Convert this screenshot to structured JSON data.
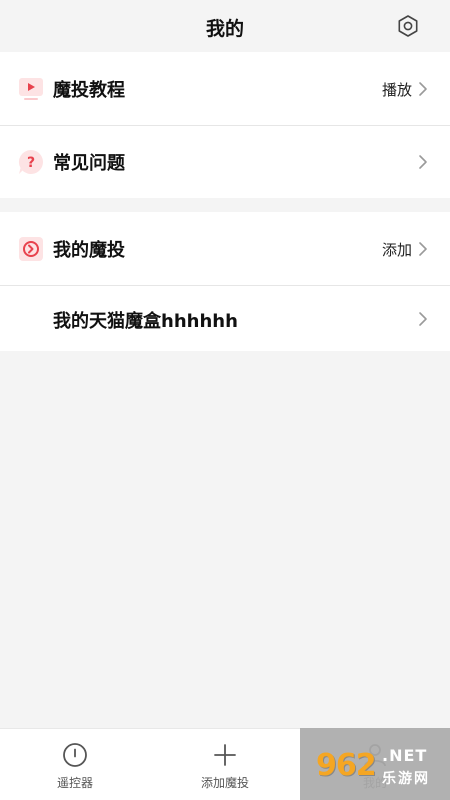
{
  "header": {
    "title": "我的",
    "settings_icon": "gear-icon"
  },
  "section1": {
    "items": [
      {
        "label": "魔投教程",
        "value": "播放",
        "icon": "play-screen-icon"
      },
      {
        "label": "常见问题",
        "value": "",
        "icon": "question-bubble-icon"
      }
    ]
  },
  "section2": {
    "items": [
      {
        "label": "我的魔投",
        "value": "添加",
        "icon": "device-icon"
      },
      {
        "label": "我的天猫魔盒hhhhhh",
        "value": ""
      }
    ]
  },
  "tabbar": {
    "tabs": [
      {
        "label": "遥控器",
        "icon": "remote-icon"
      },
      {
        "label": "添加魔投",
        "icon": "plus-icon"
      },
      {
        "label": "我的",
        "icon": "user-icon"
      }
    ]
  },
  "watermark": {
    "text": "962.NET",
    "sub": "乐游网"
  },
  "colors": {
    "accent": "#e8424d",
    "icon_bg": "#fde3e4",
    "background": "#f4f4f4"
  }
}
